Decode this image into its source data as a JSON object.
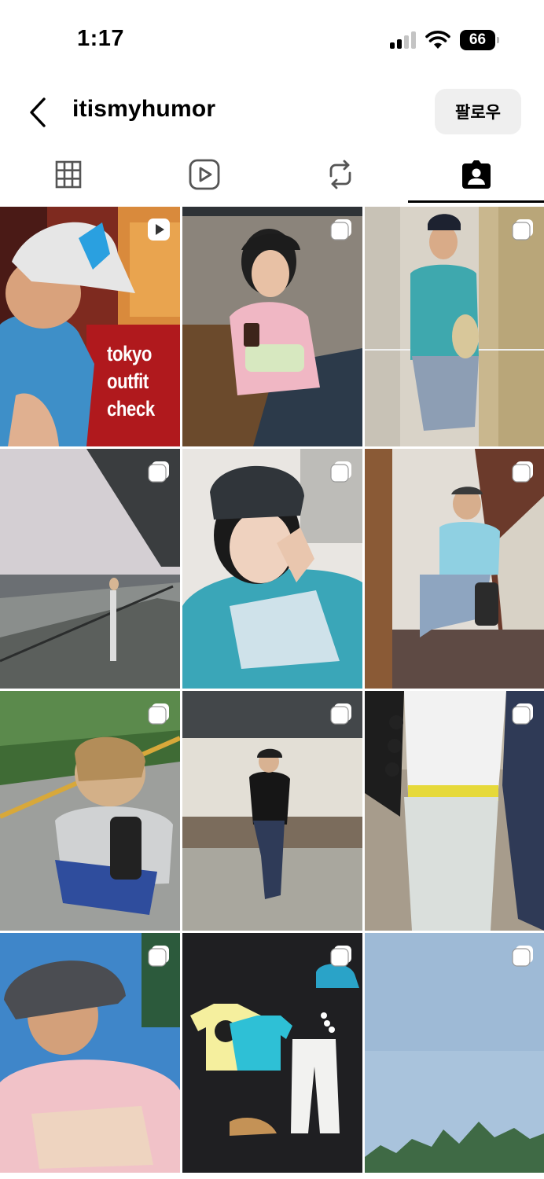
{
  "status_bar": {
    "time": "1:17",
    "battery_level": "66",
    "signal_bars_active": 2,
    "signal_bars_total": 4
  },
  "header": {
    "back_icon": "chevron-left-icon",
    "username": "itismyhumor",
    "follow_label": "팔로우"
  },
  "tabs": [
    {
      "icon": "grid-icon",
      "active": false
    },
    {
      "icon": "reels-icon",
      "active": false
    },
    {
      "icon": "reposts-icon",
      "active": false
    },
    {
      "icon": "tagged-icon",
      "active": true
    }
  ],
  "grid": {
    "tile_1_overlay": [
      "tokyo",
      "outfit",
      "check"
    ],
    "tile_1_badge": "reel-icon",
    "other_badge": "multi-post-icon"
  },
  "colors": {
    "accent": "#000000",
    "follow_button_bg": "#efefef"
  }
}
